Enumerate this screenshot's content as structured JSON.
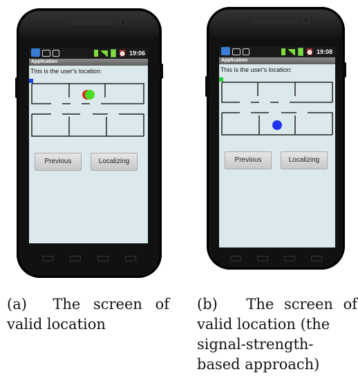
{
  "phones": [
    {
      "status_time": "19:06",
      "app_title": "Application",
      "location_text": "This is the user's location:",
      "buttons": {
        "previous": "Previous",
        "localizing": "Localizing"
      },
      "marker_color": "#1f3fe0"
    },
    {
      "status_time": "19:08",
      "app_title": "Application",
      "location_text": "This is the user's location:",
      "buttons": {
        "previous": "Previous",
        "localizing": "Localizing"
      },
      "marker_color": "#22cc33"
    }
  ],
  "captions": {
    "a": {
      "label": "(a)",
      "lines": [
        "The screen of",
        "valid location"
      ]
    },
    "b": {
      "label": "(b)",
      "lines": [
        "The screen of",
        "valid location (the",
        "signal-strength-",
        "based approach)"
      ]
    }
  },
  "colors": {
    "screen_bg": "#dce9ec",
    "wall": "#222222",
    "estimate_red": "#d83020",
    "estimate_green": "#44dd22",
    "estimate_blue": "#2233ee"
  }
}
